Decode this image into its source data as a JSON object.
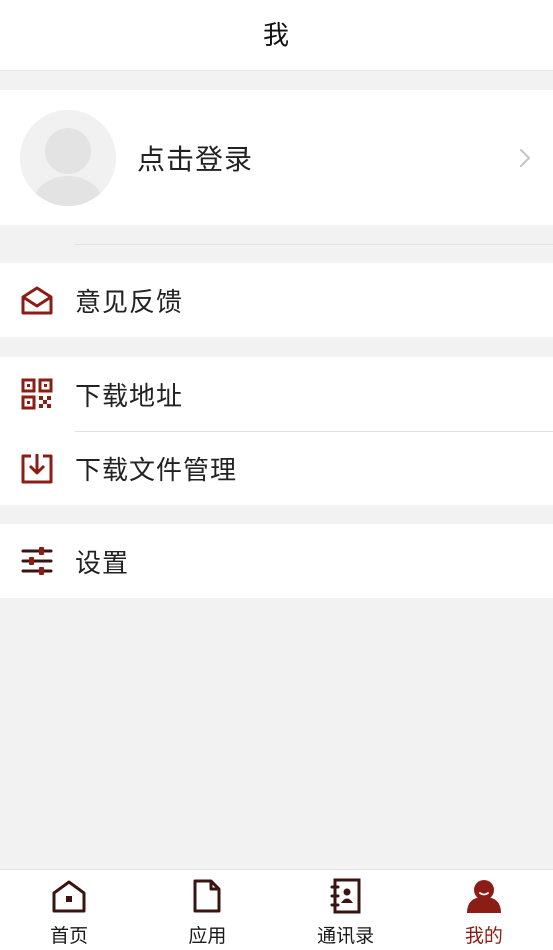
{
  "header": {
    "title": "我"
  },
  "profile": {
    "login_label": "点击登录",
    "avatar_icon": "default-avatar-icon",
    "chevron_icon": "chevron-right-icon"
  },
  "menu": {
    "feedback": {
      "label": "意见反馈",
      "icon": "envelope-open-icon"
    },
    "download_address": {
      "label": "下载地址",
      "icon": "qr-code-icon"
    },
    "download_manager": {
      "label": "下载文件管理",
      "icon": "download-tray-icon"
    },
    "settings": {
      "label": "设置",
      "icon": "sliders-icon"
    }
  },
  "tabbar": {
    "tabs": [
      {
        "label": "首页",
        "icon": "home-icon",
        "active": false
      },
      {
        "label": "应用",
        "icon": "document-icon",
        "active": false
      },
      {
        "label": "通讯录",
        "icon": "contacts-book-icon",
        "active": false
      },
      {
        "label": "我的",
        "icon": "user-icon",
        "active": true
      }
    ]
  },
  "colors": {
    "accent": "#8b1d14",
    "icon_dark": "#3a1410",
    "background": "#f2f2f2",
    "text": "#222222"
  }
}
